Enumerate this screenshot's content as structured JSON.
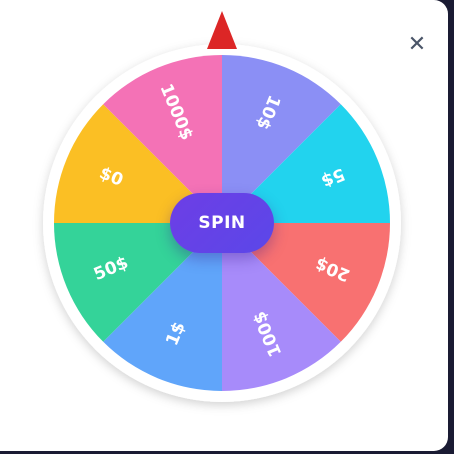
{
  "modal": {
    "close_label": "✕"
  },
  "wheel": {
    "spin_label": "SPIN",
    "segments": [
      {
        "label": "10$",
        "color": "#8b8ff5"
      },
      {
        "label": "5$",
        "color": "#22d3ee"
      },
      {
        "label": "20$",
        "color": "#f87171"
      },
      {
        "label": "100$",
        "color": "#a78bfa"
      },
      {
        "label": "1$",
        "color": "#60a5fa"
      },
      {
        "label": "50$",
        "color": "#34d399"
      },
      {
        "label": "$0",
        "color": "#fbbf24"
      },
      {
        "label": "1000$",
        "color": "#f472b6"
      }
    ],
    "pointer_color": "#dc2626",
    "rim_color": "#ffffff"
  }
}
